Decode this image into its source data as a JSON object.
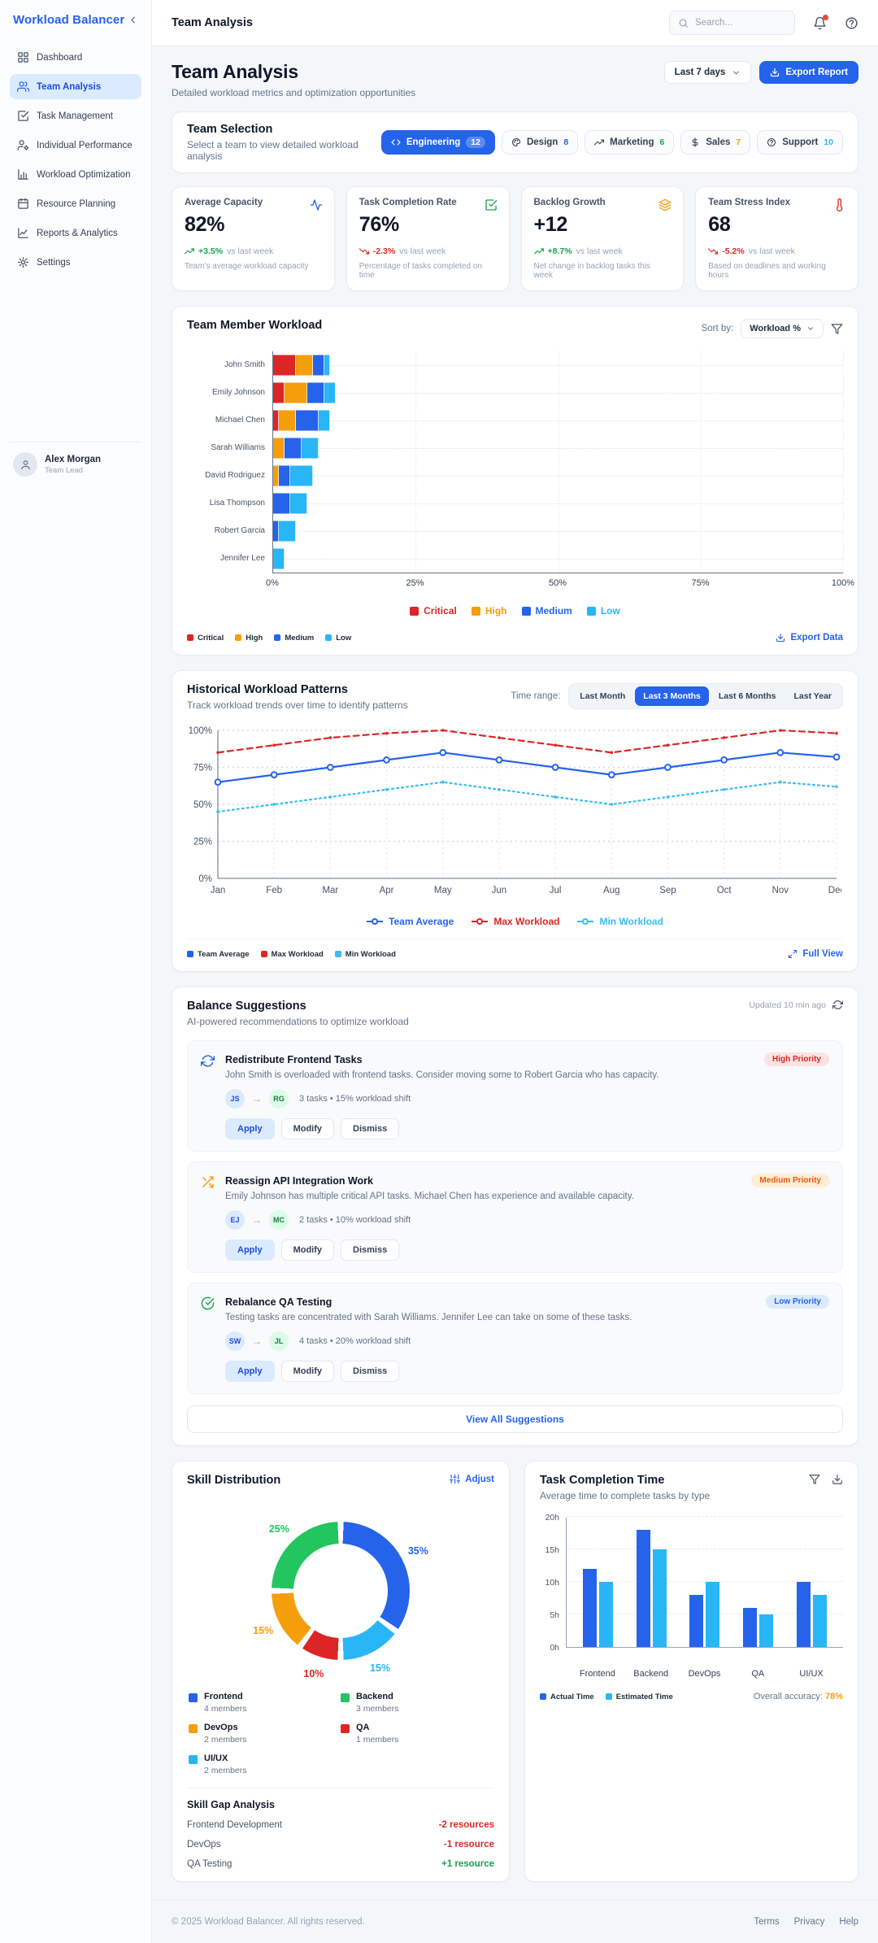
{
  "sidebar": {
    "logo": "Workload Balancer",
    "items": [
      {
        "label": "Dashboard",
        "icon": "dashboard",
        "active": false
      },
      {
        "label": "Team Analysis",
        "icon": "users",
        "active": true
      },
      {
        "label": "Task Management",
        "icon": "check-square",
        "active": false
      },
      {
        "label": "Individual Performance",
        "icon": "user-cog",
        "active": false
      },
      {
        "label": "Workload Optimization",
        "icon": "bar-box",
        "active": false
      },
      {
        "label": "Resource Planning",
        "icon": "calendar",
        "active": false
      },
      {
        "label": "Reports & Analytics",
        "icon": "line-box",
        "active": false
      },
      {
        "label": "Settings",
        "icon": "gear",
        "active": false
      }
    ],
    "user": {
      "name": "Alex Morgan",
      "role": "Team Lead"
    }
  },
  "topbar": {
    "title": "Team Analysis",
    "search_placeholder": "Search..."
  },
  "page": {
    "title": "Team Analysis",
    "subtitle": "Detailed workload metrics and optimization opportunities",
    "range_value": "Last 7 days",
    "export_label": "Export Report"
  },
  "team_selection": {
    "title": "Team Selection",
    "subtitle": "Select a team to view detailed workload analysis",
    "teams": [
      {
        "name": "Engineering",
        "count": "12",
        "icon": "code",
        "active": true,
        "count_color": "#ffffff"
      },
      {
        "name": "Design",
        "count": "8",
        "icon": "palette",
        "active": false,
        "count_color": "#2563eb"
      },
      {
        "name": "Marketing",
        "count": "6",
        "icon": "trend",
        "active": false,
        "count_color": "#16a34a"
      },
      {
        "name": "Sales",
        "count": "7",
        "icon": "dollar",
        "active": false,
        "count_color": "#f59e0b"
      },
      {
        "name": "Support",
        "count": "10",
        "icon": "help",
        "active": false,
        "count_color": "#29b6f6"
      }
    ]
  },
  "metrics": [
    {
      "label": "Average Capacity",
      "value": "82%",
      "delta": "+3.5%",
      "dir": "up",
      "delta_color": "#16a34a",
      "vs": "vs last week",
      "desc": "Team's average workload capacity",
      "icon": "activity",
      "icon_color": "#2563eb"
    },
    {
      "label": "Task Completion Rate",
      "value": "76%",
      "delta": "-2.3%",
      "dir": "down",
      "delta_color": "#dc2626",
      "vs": "vs last week",
      "desc": "Percentage of tasks completed on time",
      "icon": "check-square",
      "icon_color": "#16a34a"
    },
    {
      "label": "Backlog Growth",
      "value": "+12",
      "delta": "+8.7%",
      "dir": "up",
      "delta_color": "#16a34a",
      "vs": "vs last week",
      "desc": "Net change in backlog tasks this week",
      "icon": "layers",
      "icon_color": "#f59e0b"
    },
    {
      "label": "Team Stress Index",
      "value": "68",
      "delta": "-5.2%",
      "dir": "down",
      "delta_color": "#dc2626",
      "vs": "vs last week",
      "desc": "Based on deadlines and working hours",
      "icon": "thermometer",
      "icon_color": "#dc2626"
    }
  ],
  "workload": {
    "title": "Team Member Workload",
    "sort_label": "Sort by:",
    "sort_value": "Workload %",
    "export_label": "Export Data"
  },
  "historical": {
    "title": "Historical Workload Patterns",
    "subtitle": "Track workload trends over time to identify patterns",
    "time_range_label": "Time range:",
    "ranges": [
      "Last Month",
      "Last 3 Months",
      "Last 6 Months",
      "Last Year"
    ],
    "active_range": 1,
    "full_view_label": "Full View"
  },
  "suggestions": {
    "title": "Balance Suggestions",
    "subtitle": "AI-powered recommendations to optimize workload",
    "updated": "Updated 10 min ago",
    "view_all": "View All Suggestions",
    "items": [
      {
        "icon": "refresh",
        "icon_color": "#2563eb",
        "title": "Redistribute Frontend Tasks",
        "priority": "High Priority",
        "priority_bg": "#fee2e2",
        "priority_fg": "#dc2626",
        "desc": "John Smith is overloaded with frontend tasks. Consider moving some to Robert Garcia who has capacity.",
        "from": "JS",
        "from_bg": "#dbeafe",
        "from_fg": "#1d4ed8",
        "to": "RG",
        "to_bg": "#dcfce7",
        "to_fg": "#15803d",
        "meta": "3 tasks • 15% workload shift",
        "actions": [
          "Apply",
          "Modify",
          "Dismiss"
        ]
      },
      {
        "icon": "shuffle",
        "icon_color": "#f59e0b",
        "title": "Reassign API Integration Work",
        "priority": "Medium Priority",
        "priority_bg": "#ffedd5",
        "priority_fg": "#ea580c",
        "desc": "Emily Johnson has multiple critical API tasks. Michael Chen has experience and available capacity.",
        "from": "EJ",
        "from_bg": "#dbeafe",
        "from_fg": "#1d4ed8",
        "to": "MC",
        "to_bg": "#dcfce7",
        "to_fg": "#15803d",
        "meta": "2 tasks • 10% workload shift",
        "actions": [
          "Apply",
          "Modify",
          "Dismiss"
        ]
      },
      {
        "icon": "check-circle",
        "icon_color": "#16a34a",
        "title": "Rebalance QA Testing",
        "priority": "Low Priority",
        "priority_bg": "#dbeafe",
        "priority_fg": "#2563eb",
        "desc": "Testing tasks are concentrated with Sarah Williams. Jennifer Lee can take on some of these tasks.",
        "from": "SW",
        "from_bg": "#dbeafe",
        "from_fg": "#1d4ed8",
        "to": "JL",
        "to_bg": "#dcfce7",
        "to_fg": "#15803d",
        "meta": "4 tasks • 20% workload shift",
        "actions": [
          "Apply",
          "Modify",
          "Dismiss"
        ]
      }
    ]
  },
  "skills": {
    "title": "Skill Distribution",
    "adjust_label": "Adjust",
    "legend": [
      {
        "name": "Frontend",
        "sub": "4 members",
        "color": "#2563eb"
      },
      {
        "name": "Backend",
        "sub": "3 members",
        "color": "#22c55e"
      },
      {
        "name": "DevOps",
        "sub": "2 members",
        "color": "#f59e0b"
      },
      {
        "name": "QA",
        "sub": "1 members",
        "color": "#dc2626"
      },
      {
        "name": "UI/UX",
        "sub": "2 members",
        "color": "#29b6f6"
      }
    ],
    "gap_title": "Skill Gap Analysis",
    "gaps": [
      {
        "skill": "Frontend Development",
        "value": "-2 resources",
        "color": "#dc2626"
      },
      {
        "skill": "DevOps",
        "value": "-1 resource",
        "color": "#dc2626"
      },
      {
        "skill": "QA Testing",
        "value": "+1 resource",
        "color": "#16a34a"
      }
    ]
  },
  "completion": {
    "title": "Task Completion Time",
    "subtitle": "Average time to complete tasks by type",
    "accuracy_label": "Overall accuracy:",
    "accuracy_value": "78%",
    "accuracy_color": "#f59e0b"
  },
  "footer": {
    "copyright": "© 2025 Workload Balancer. All rights reserved.",
    "links": [
      "Terms",
      "Privacy",
      "Help"
    ]
  },
  "chart_data": [
    {
      "id": "team_member_workload",
      "type": "bar",
      "orientation": "horizontal",
      "stacked": true,
      "title": "Team Member Workload",
      "categories": [
        "John Smith",
        "Emily Johnson",
        "Michael Chen",
        "Sarah Williams",
        "David Rodriguez",
        "Lisa Thompson",
        "Robert Garcia",
        "Jennifer Lee"
      ],
      "series": [
        {
          "name": "Critical",
          "color": "#dc2626",
          "values": [
            4,
            2,
            1,
            0,
            0,
            0,
            0,
            0
          ]
        },
        {
          "name": "High",
          "color": "#f59e0b",
          "values": [
            3,
            4,
            3,
            2,
            1,
            0,
            0,
            0
          ]
        },
        {
          "name": "Medium",
          "color": "#2563eb",
          "values": [
            2,
            3,
            4,
            3,
            2,
            3,
            1,
            0
          ]
        },
        {
          "name": "Low",
          "color": "#29b6f6",
          "values": [
            1,
            2,
            2,
            3,
            4,
            3,
            3,
            2
          ]
        }
      ],
      "xlim": [
        0,
        100
      ],
      "x_ticks": [
        "0%",
        "25%",
        "50%",
        "75%",
        "100%"
      ],
      "grid": true,
      "legend_position": "bottom-center"
    },
    {
      "id": "historical_patterns",
      "type": "line",
      "x": [
        "Jan",
        "Feb",
        "Mar",
        "Apr",
        "May",
        "Jun",
        "Jul",
        "Aug",
        "Sep",
        "Oct",
        "Nov",
        "Dec"
      ],
      "ylim": [
        0,
        100
      ],
      "y_ticks": [
        "0%",
        "25%",
        "50%",
        "75%",
        "100%"
      ],
      "grid": true,
      "series": [
        {
          "name": "Team Average",
          "color": "#2563eb",
          "style": "solid",
          "values": [
            65,
            70,
            75,
            80,
            85,
            80,
            75,
            70,
            75,
            80,
            85,
            82
          ]
        },
        {
          "name": "Max Workload",
          "color": "#dc2626",
          "style": "dashed",
          "values": [
            85,
            90,
            95,
            98,
            100,
            95,
            90,
            85,
            90,
            95,
            100,
            98
          ]
        },
        {
          "name": "Min Workload",
          "color": "#38bdf8",
          "style": "dotted",
          "values": [
            45,
            50,
            55,
            60,
            65,
            60,
            55,
            50,
            55,
            60,
            65,
            62
          ]
        }
      ],
      "legend_position": "bottom-center"
    },
    {
      "id": "skill_distribution",
      "type": "pie",
      "labels": [
        "Frontend",
        "UI/UX",
        "QA",
        "DevOps",
        "Backend"
      ],
      "values": [
        35,
        15,
        10,
        15,
        25
      ],
      "colors": [
        "#2563eb",
        "#29b6f6",
        "#dc2626",
        "#f59e0b",
        "#22c55e"
      ],
      "data_labels": [
        "35%",
        "15%",
        "10%",
        "15%",
        "25%"
      ]
    },
    {
      "id": "task_completion_time",
      "type": "bar",
      "categories": [
        "Frontend",
        "Backend",
        "DevOps",
        "QA",
        "UI/UX"
      ],
      "series": [
        {
          "name": "Actual Time",
          "color": "#2563eb",
          "values": [
            12,
            18,
            8,
            6,
            10
          ]
        },
        {
          "name": "Estimated Time",
          "color": "#29b6f6",
          "values": [
            10,
            15,
            10,
            5,
            8
          ]
        }
      ],
      "ylim": [
        0,
        20
      ],
      "y_ticks": [
        "0h",
        "5h",
        "10h",
        "15h",
        "20h"
      ],
      "grid": true,
      "legend_position": "bottom-left"
    }
  ]
}
